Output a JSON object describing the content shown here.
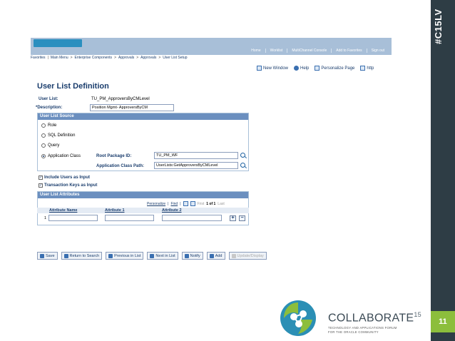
{
  "slide": {
    "tag": "#C15LV",
    "page_number": "11"
  },
  "header": {
    "top_links": [
      "Home",
      "Worklist",
      "MultiChannel Console",
      "Add to Favorites",
      "Sign out"
    ]
  },
  "breadcrumb": [
    "Favorites",
    "Main Menu",
    "Enterprise Components",
    "Approvals",
    "Approvals",
    "User List Setup"
  ],
  "page_links": {
    "new_window": "New Window",
    "help": "Help",
    "personalize_page": "Personalize Page",
    "http": "http"
  },
  "page_title": "User List Definition",
  "user_list": {
    "label": "User List:",
    "value": "TU_PM_ApproversByCMLevel"
  },
  "description": {
    "label": "*Description:",
    "value": "Position Mgmt- ApproversByCM"
  },
  "source": {
    "title": "User List Source",
    "options": [
      "Role",
      "SQL Definition",
      "Query",
      "Application Class"
    ],
    "selected": "Application Class",
    "root_package_label": "Root Package ID:",
    "root_package_value": "TU_PM_WF",
    "app_class_path_label": "Application Class Path:",
    "app_class_path_value": "UserLists:GetApproversByCMLevel"
  },
  "checkboxes": {
    "include_users": "Include Users as Input",
    "transaction_keys": "Transaction Keys as Input"
  },
  "attributes": {
    "title": "User List Attributes",
    "nav": {
      "personalize": "Personalize",
      "find": "Find",
      "first": "First",
      "count": "1 of 1",
      "last": "Last"
    },
    "columns": [
      "Attribute Name",
      "Attribute 1",
      "Attribute 2"
    ],
    "row_number": "1",
    "add_symbol": "+",
    "remove_symbol": "−"
  },
  "toolbar": {
    "save": "Save",
    "return_to_search": "Return to Search",
    "previous_in_list": "Previous in List",
    "next_in_list": "Next in List",
    "notify": "Notify",
    "add": "Add",
    "update_display": "Update/Display"
  },
  "branding": {
    "name": "COLLABORATE",
    "year": "15",
    "tagline_1": "TECHNOLOGY AND APPLICATIONS FORUM",
    "tagline_2": "FOR THE ORACLE COMMUNITY"
  },
  "colors": {
    "header_bg": "#a8bfd8",
    "group_title_bg": "#6b8fbf",
    "link_text": "#1a3d6d",
    "slide_bar": "#2e3d45",
    "accent_green": "#8cbe3c"
  }
}
